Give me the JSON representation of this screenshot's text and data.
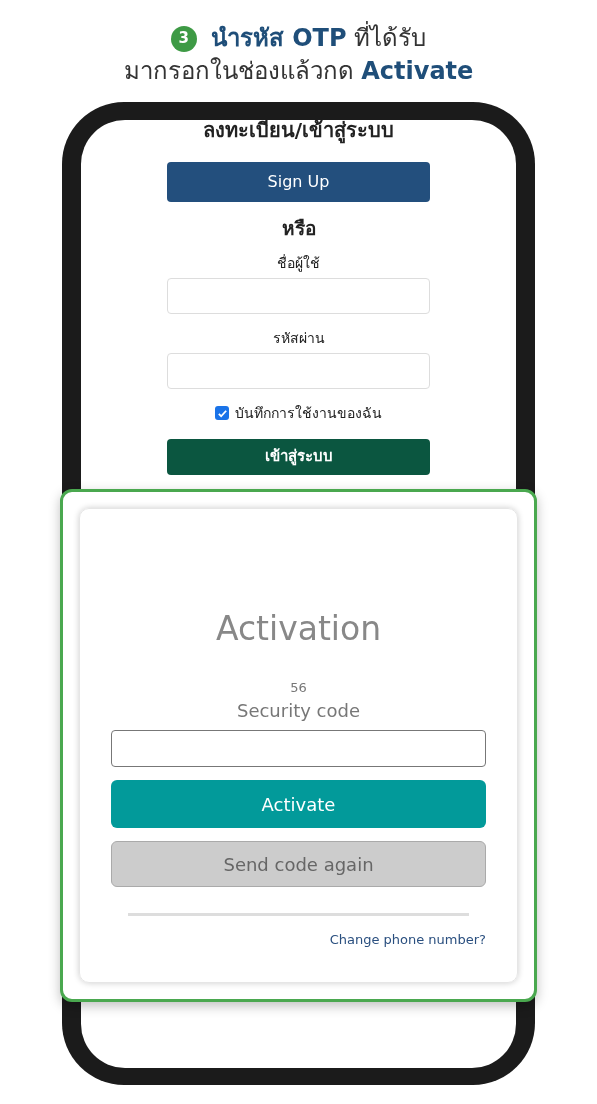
{
  "instruction": {
    "step": "3",
    "lines": [
      [
        {
          "text": "นำรหัส OTP",
          "emphasis": true
        },
        {
          "text": " ที่ได้รับ",
          "emphasis": false
        }
      ],
      [
        {
          "text": "มากรอกในช่องแล้วกด ",
          "emphasis": false
        },
        {
          "text": "Activate",
          "emphasis": true
        }
      ]
    ]
  },
  "login_screen": {
    "title": "ลงทะเบียน/เข้าสู่ระบบ",
    "signup_button": "Sign Up",
    "or_label": "หรือ",
    "username_label": "ชื่อผู้ใช้",
    "password_label": "รหัสผ่าน",
    "remember": {
      "label": "บันทึกการใช้งานของฉัน",
      "checked": true
    },
    "login_button": "เข้าสู่ระบบ"
  },
  "activation": {
    "title": "Activation",
    "code_hint": "56",
    "field_label": "Security code",
    "activate_button": "Activate",
    "resend_button": {
      "label": "Send code again",
      "disabled": true
    },
    "change_link": "Change phone number?"
  }
}
